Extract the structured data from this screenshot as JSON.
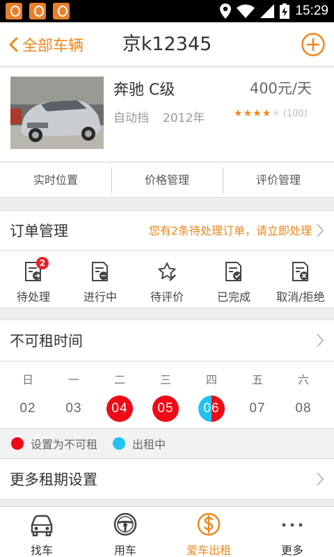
{
  "status_bar": {
    "time": "15:29",
    "notification_icons": [
      "app-notification-icon",
      "app-notification-icon",
      "app-notification-icon"
    ]
  },
  "header": {
    "back_label": "全部车辆",
    "title": "京k12345",
    "add_icon": "plus-circle-icon"
  },
  "car": {
    "name": "奔驰 C级",
    "price": "400元/天",
    "transmission": "自动挡",
    "year": "2012年",
    "rating": 4,
    "rating_max": 5,
    "rating_count": "(100)"
  },
  "tabs": [
    {
      "label": "实时位置"
    },
    {
      "label": "价格管理"
    },
    {
      "label": "评价管理"
    }
  ],
  "orders": {
    "label": "订单管理",
    "notice": "您有2条待处理订单，请立即处理",
    "items": [
      {
        "label": "待处理",
        "icon": "pending-order-icon",
        "badge": "2"
      },
      {
        "label": "进行中",
        "icon": "in-progress-order-icon"
      },
      {
        "label": "待评价",
        "icon": "to-review-icon"
      },
      {
        "label": "已完成",
        "icon": "completed-order-icon"
      },
      {
        "label": "取消/拒绝",
        "icon": "cancelled-order-icon"
      }
    ]
  },
  "unavailable": {
    "label": "不可租时间",
    "weekdays": [
      "日",
      "一",
      "二",
      "三",
      "四",
      "五",
      "六"
    ],
    "days": [
      {
        "date": "02",
        "state": "normal"
      },
      {
        "date": "03",
        "state": "normal"
      },
      {
        "date": "04",
        "state": "unavailable"
      },
      {
        "date": "05",
        "state": "unavailable"
      },
      {
        "date": "06",
        "state": "renting-and-unavailable"
      },
      {
        "date": "07",
        "state": "normal"
      },
      {
        "date": "08",
        "state": "normal"
      }
    ],
    "legend": [
      {
        "label": "设置为不可租",
        "color": "#ee0b15"
      },
      {
        "label": "出租中",
        "color": "#21c2f2"
      }
    ]
  },
  "more_settings": {
    "label": "更多租期设置"
  },
  "bottom_nav": [
    {
      "label": "找车",
      "icon": "car-front-icon",
      "active": false
    },
    {
      "label": "用车",
      "icon": "steering-wheel-icon",
      "active": false
    },
    {
      "label": "爱车出租",
      "icon": "dollar-circle-icon",
      "active": true
    },
    {
      "label": "更多",
      "icon": "more-dots-icon",
      "active": false
    }
  ],
  "colors": {
    "accent": "#f08519",
    "badge": "#e8212b",
    "unavailable": "#ee0b15",
    "renting": "#21c2f2",
    "star_on": "#f08519",
    "star_off": "#dddddd"
  }
}
